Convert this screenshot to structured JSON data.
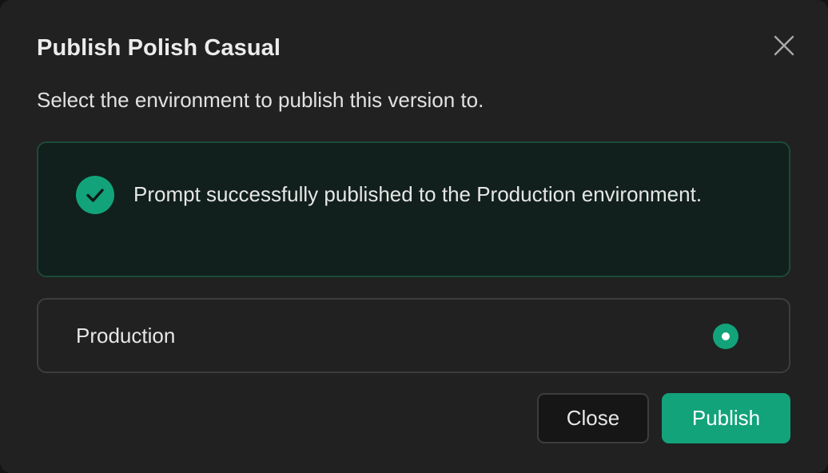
{
  "dialog": {
    "title": "Publish Polish Casual",
    "subtitle": "Select the environment to publish this version to."
  },
  "success_alert": {
    "icon": "check-circle-icon",
    "message": "Prompt successfully published to the Production environment."
  },
  "environments": [
    {
      "label": "Production",
      "selected": true
    }
  ],
  "buttons": {
    "close_label": "Close",
    "publish_label": "Publish"
  },
  "colors": {
    "accent": "#12a37a",
    "background": "#212121",
    "success_background": "#11201c",
    "success_border": "#1d4a38"
  }
}
